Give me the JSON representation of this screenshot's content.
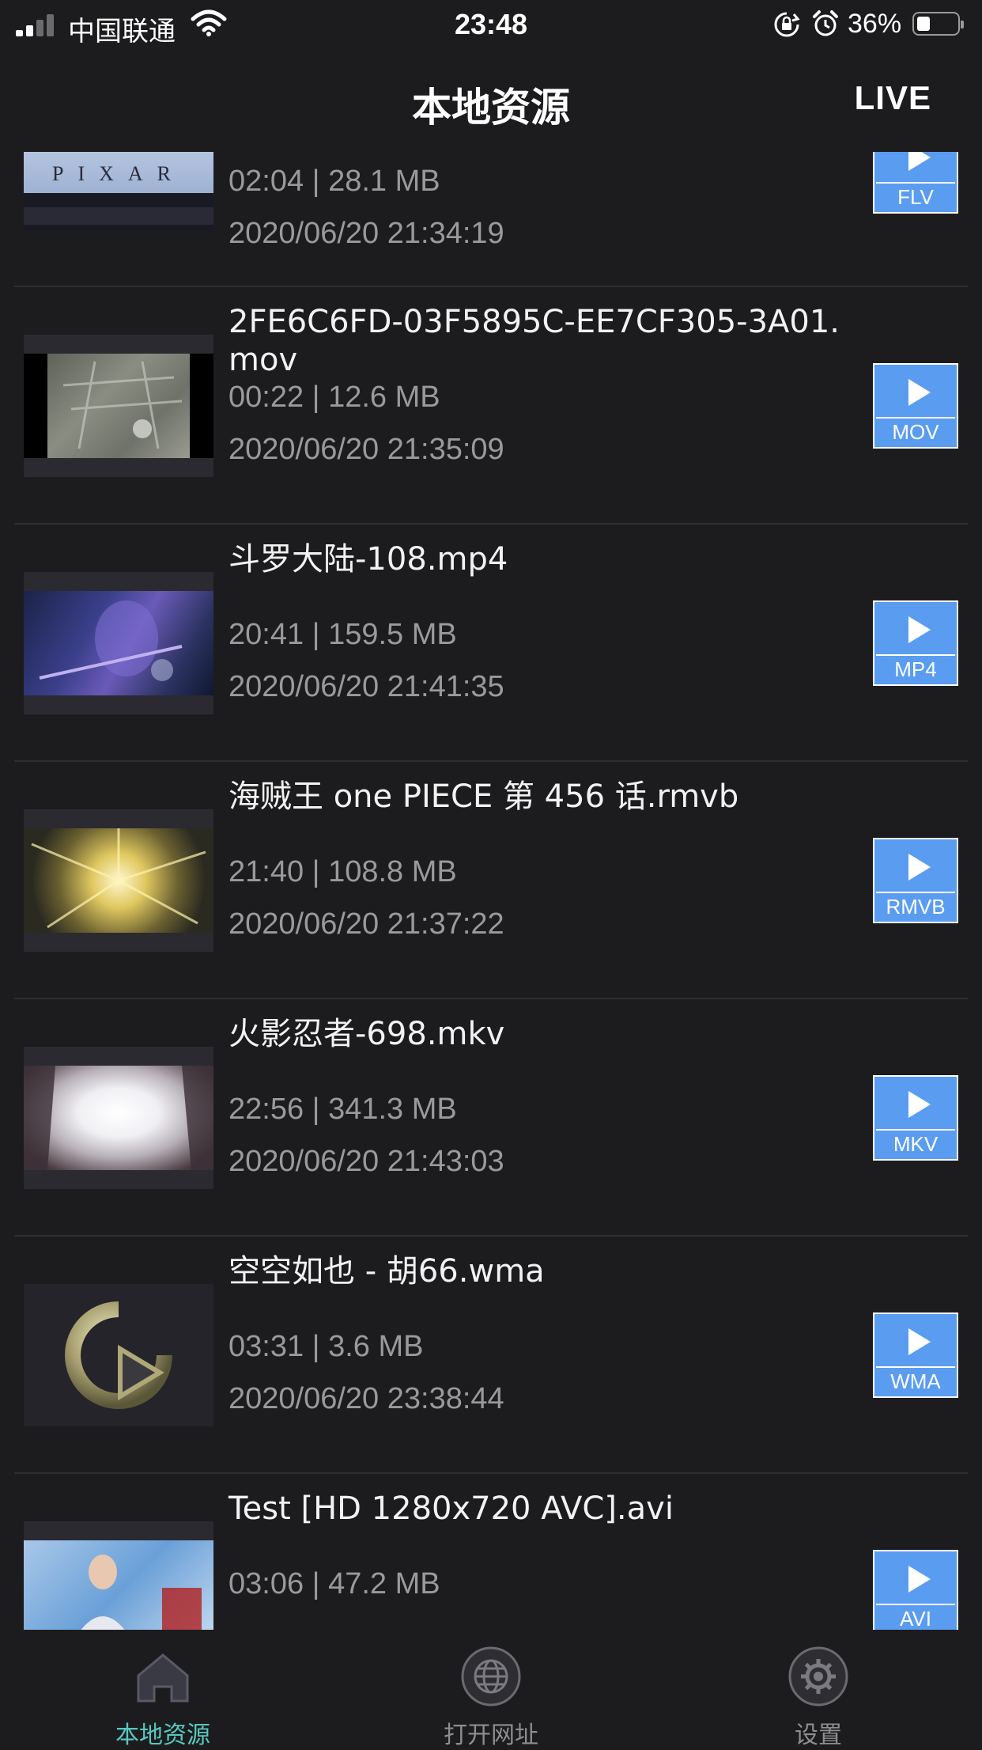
{
  "status_bar": {
    "carrier": "中国联通",
    "time": "23:48",
    "battery_percent": "36%",
    "battery_level": 0.36
  },
  "nav": {
    "title": "本地资源",
    "live_label": "LIVE"
  },
  "items": [
    {
      "title": "",
      "duration_size": "02:04 | 28.1 MB",
      "date": "2020/06/20 21:34:19",
      "format": "FLV"
    },
    {
      "title": "2FE6C6FD-03F5895C-EE7CF305-3A01.\nmov",
      "duration_size": "00:22 | 12.6 MB",
      "date": "2020/06/20 21:35:09",
      "format": "MOV"
    },
    {
      "title": "斗罗大陆-108.mp4",
      "duration_size": "20:41 | 159.5 MB",
      "date": "2020/06/20 21:41:35",
      "format": "MP4"
    },
    {
      "title": "海贼王 one PIECE 第 456 话.rmvb",
      "duration_size": "21:40 | 108.8 MB",
      "date": "2020/06/20 21:37:22",
      "format": "RMVB"
    },
    {
      "title": "火影忍者-698.mkv",
      "duration_size": "22:56 | 341.3 MB",
      "date": "2020/06/20 21:43:03",
      "format": "MKV"
    },
    {
      "title": "空空如也 - 胡66.wma",
      "duration_size": "03:31 | 3.6 MB",
      "date": "2020/06/20 23:38:44",
      "format": "WMA"
    },
    {
      "title": "Test [HD 1280x720 AVC].avi",
      "duration_size": "03:06 | 47.2 MB",
      "date": "",
      "format": "AVI"
    }
  ],
  "tabs": [
    {
      "label": "本地资源",
      "icon": "home-icon",
      "active": true
    },
    {
      "label": "打开网址",
      "icon": "globe-icon",
      "active": false
    },
    {
      "label": "设置",
      "icon": "gear-icon",
      "active": false
    }
  ],
  "colors": {
    "background": "#1c1c1e",
    "badge": "#5a9cf0",
    "active_tab": "#58c8c0",
    "secondary_text": "#9a9a9a"
  }
}
